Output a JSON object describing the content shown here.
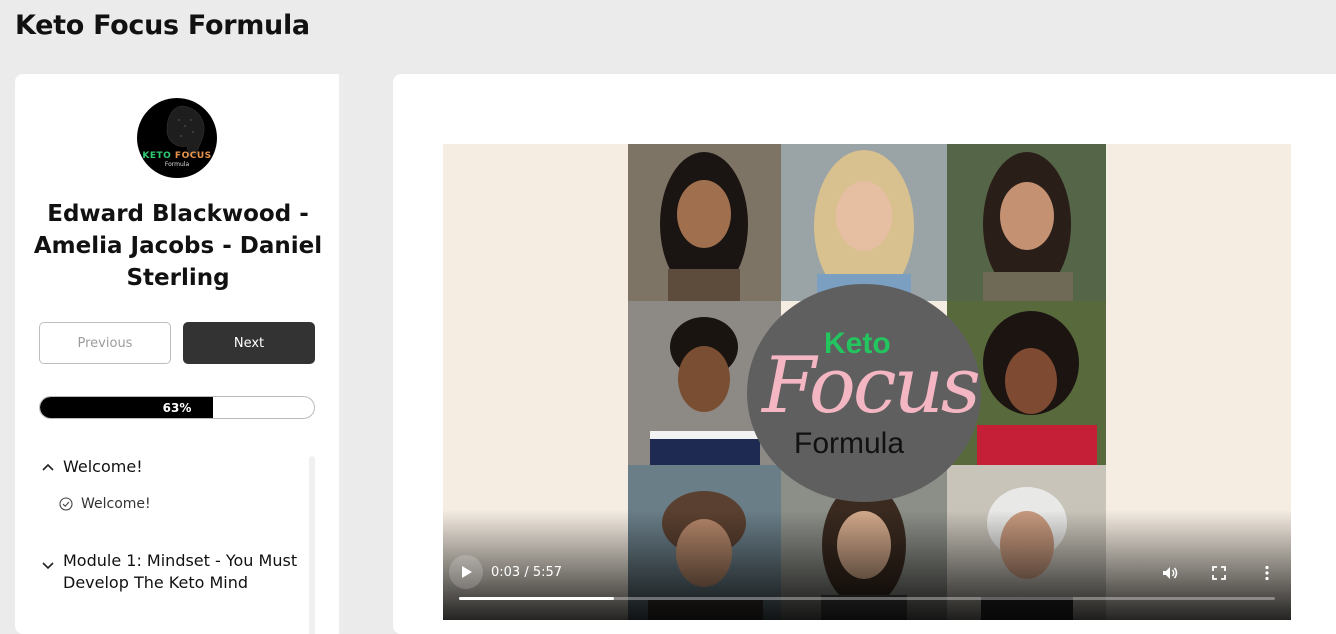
{
  "page": {
    "title": "Keto Focus Formula"
  },
  "sidebar": {
    "logo": {
      "line1_green": "KETO",
      "line1_orange": "FOCUS",
      "line2": "Formula"
    },
    "course_title": "Edward Blackwood - Amelia Jacobs - Daniel Sterling",
    "previous_label": "Previous",
    "next_label": "Next",
    "progress": {
      "label": "63%",
      "fraction": 0.63
    },
    "sections": [
      {
        "label": "Welcome!",
        "expanded": true,
        "lessons": [
          {
            "label": "Welcome!",
            "status": "check-circle-icon"
          }
        ]
      },
      {
        "label": "Module 1: Mindset - You Must Develop The Keto Mind",
        "expanded": false,
        "lessons": []
      }
    ]
  },
  "video": {
    "overlay_logo": {
      "keto": "Keto",
      "focus": "Focus",
      "formula": "Formula"
    },
    "time": "0:03 / 5:57",
    "played_fraction": 0.19,
    "colors": {
      "keto_green": "#22c55e",
      "focus_pink": "#f4b6c2",
      "circle_gray": "#5f5f60"
    }
  }
}
